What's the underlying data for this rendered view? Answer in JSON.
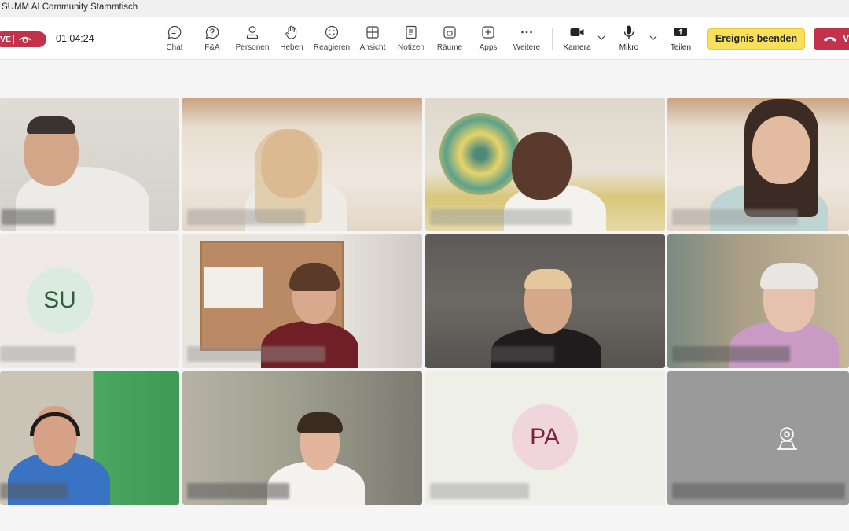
{
  "window": {
    "title": "SUMM AI Community Stammtisch"
  },
  "status": {
    "live_label": "VE",
    "elapsed": "01:04:24"
  },
  "toolbar": {
    "chat": "Chat",
    "qa": "F&A",
    "people": "Personen",
    "raise": "Heben",
    "react": "Reagieren",
    "view": "Ansicht",
    "notes": "Notizen",
    "rooms": "Räume",
    "apps": "Apps",
    "more": "Weitere",
    "camera": "Kamera",
    "mic": "Mikro",
    "share": "Teilen",
    "end_event": "Ereignis beenden",
    "leave": "V"
  },
  "participants": {
    "avatar_su": "SU",
    "avatar_pa": "PA"
  },
  "icons": {
    "chat": "chat-bubble-icon",
    "qa": "question-bubble-icon",
    "people": "person-icon",
    "raise": "raise-hand-icon",
    "react": "smiley-icon",
    "view": "grid-view-icon",
    "notes": "notes-icon",
    "rooms": "breakout-rooms-icon",
    "apps": "apps-plus-icon",
    "more": "ellipsis-icon",
    "camera": "video-camera-icon",
    "mic": "microphone-icon",
    "share": "share-screen-icon",
    "leave": "phone-hangup-icon"
  },
  "colors": {
    "live": "#c4314b",
    "end_event": "#f9e05b",
    "leave": "#c4314b",
    "avatar_su_bg": "#dcebe0",
    "avatar_su_fg": "#2e5e3e",
    "avatar_pa_bg": "#f0d6dc",
    "avatar_pa_fg": "#7a2040"
  }
}
